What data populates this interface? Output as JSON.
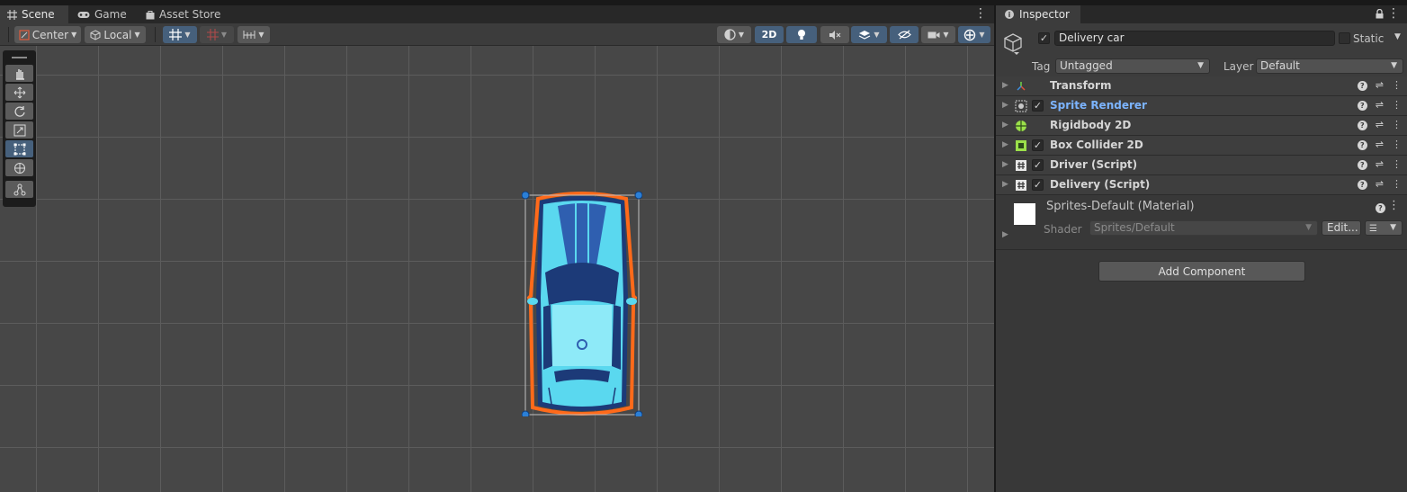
{
  "scene_tabs": [
    {
      "label": "Scene",
      "icon": "grid-icon",
      "active": true
    },
    {
      "label": "Game",
      "icon": "gamepad-icon",
      "active": false
    },
    {
      "label": "Asset Store",
      "icon": "bag-icon",
      "active": false
    }
  ],
  "toolbar": {
    "pivot_label": "Center",
    "space_label": "Local",
    "mode_2d_label": "2D"
  },
  "inspector": {
    "tab_label": "Inspector",
    "object_name": "Delivery car",
    "static_label": "Static",
    "tag_label": "Tag",
    "tag_value": "Untagged",
    "layer_label": "Layer",
    "layer_value": "Default",
    "components": [
      {
        "name": "Transform",
        "icon": "transform-icon",
        "has_checkbox": false,
        "link": false
      },
      {
        "name": "Sprite Renderer",
        "icon": "sprite-renderer-icon",
        "has_checkbox": true,
        "link": true
      },
      {
        "name": "Rigidbody 2D",
        "icon": "rigidbody-icon",
        "has_checkbox": false,
        "link": false
      },
      {
        "name": "Box Collider 2D",
        "icon": "box-collider-icon",
        "has_checkbox": true,
        "link": false
      },
      {
        "name": "Driver (Script)",
        "icon": "script-icon",
        "has_checkbox": true,
        "link": false
      },
      {
        "name": "Delivery (Script)",
        "icon": "script-icon",
        "has_checkbox": true,
        "link": false
      }
    ],
    "material": {
      "name": "Sprites-Default (Material)",
      "shader_label": "Shader",
      "shader_value": "Sprites/Default",
      "edit_label": "Edit..."
    },
    "add_component_label": "Add Component"
  },
  "colors": {
    "accent_blue": "#46607c",
    "link_blue": "#7cb4ff",
    "selection_outline": "#ff6a1a",
    "car_body": "#5ad8ef",
    "car_dark": "#1c3a78"
  }
}
